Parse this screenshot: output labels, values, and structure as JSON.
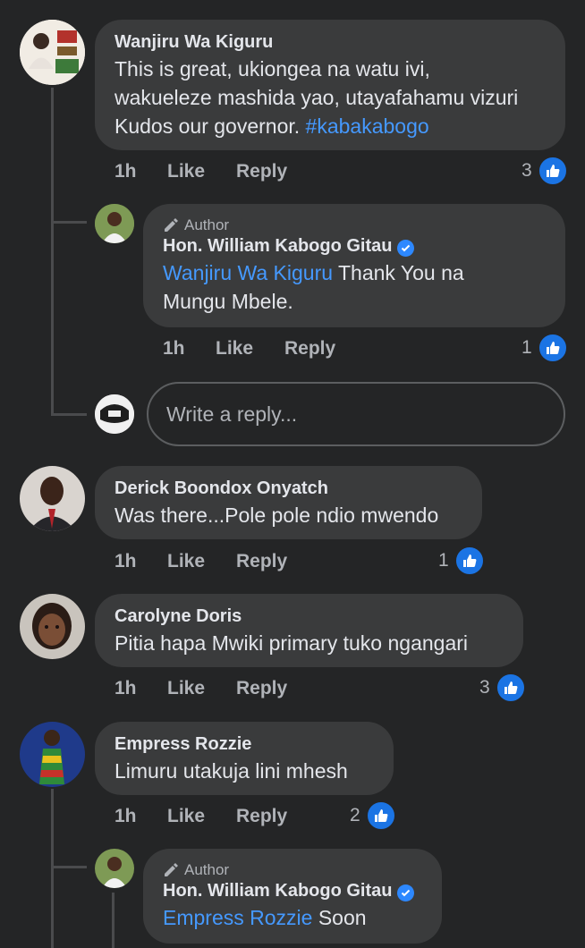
{
  "comments": [
    {
      "name": "Wanjiru Wa Kiguru",
      "text_lines": [
        "This is great, ukiongea na watu ivi,",
        "wakueleze mashida yao, utayafahamu vizuri",
        "Kudos our governor. "
      ],
      "hashtag": "#kabakabogo",
      "time": "1h",
      "like": "Like",
      "reply": "Reply",
      "reactions": "3",
      "replies": [
        {
          "author_tag": "Author",
          "name": "Hon. William Kabogo Gitau",
          "mention": "Wanjiru Wa Kiguru",
          "text_after_mention": " Thank You na",
          "text_line2": "Mungu Mbele.",
          "time": "1h",
          "like": "Like",
          "reply": "Reply",
          "reactions": "1"
        }
      ],
      "reply_placeholder": "Write a reply..."
    },
    {
      "name": "Derick Boondox Onyatch",
      "text": "Was there...Pole pole ndio mwendo",
      "time": "1h",
      "like": "Like",
      "reply": "Reply",
      "reactions": "1"
    },
    {
      "name": "Carolyne Doris",
      "text": "Pitia hapa Mwiki primary tuko ngangari",
      "time": "1h",
      "like": "Like",
      "reply": "Reply",
      "reactions": "3"
    },
    {
      "name": "Empress Rozzie",
      "text": "Limuru utakuja lini mhesh",
      "time": "1h",
      "like": "Like",
      "reply": "Reply",
      "reactions": "2",
      "replies": [
        {
          "author_tag": "Author",
          "name": "Hon. William Kabogo Gitau",
          "mention": "Empress Rozzie",
          "text_after_mention": " Soon"
        }
      ]
    }
  ],
  "icons": {
    "like": "thumbs-up-icon",
    "author": "pencil-icon",
    "verified": "verified-check-icon"
  },
  "colors": {
    "background": "#242526",
    "bubble": "#3a3b3c",
    "link": "#4599ff",
    "like_badge": "#1b74e4"
  }
}
